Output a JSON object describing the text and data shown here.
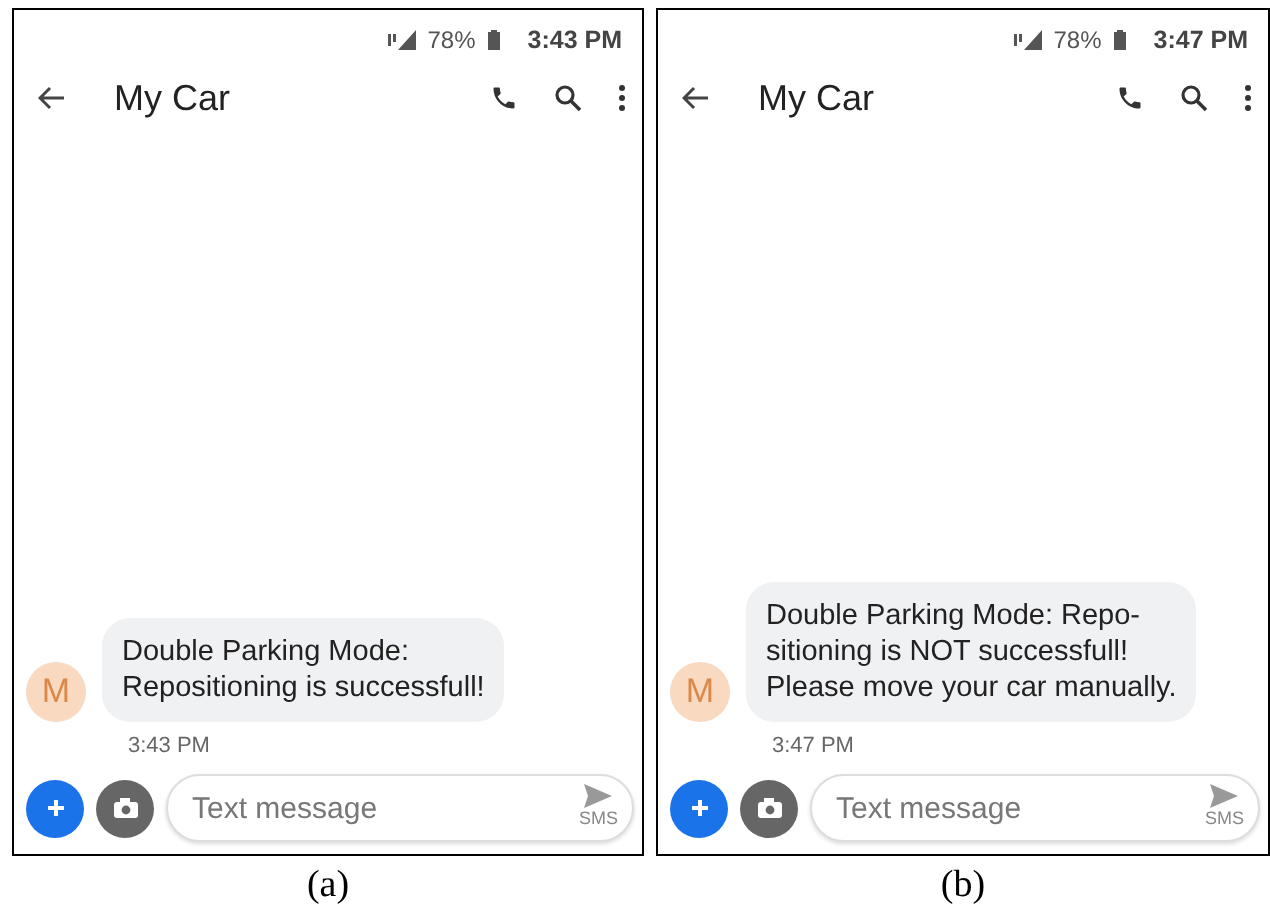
{
  "panels": [
    {
      "caption": "(a)",
      "status_bar": {
        "battery": "78%",
        "time": "3:43 PM"
      },
      "toolbar": {
        "title": "My Car"
      },
      "message": {
        "avatar": "M",
        "lines": [
          "Double Parking Mode:",
          "Repositioning is successfull!"
        ],
        "time": "3:43 PM"
      },
      "composer": {
        "placeholder": "Text message",
        "send_label": "SMS"
      }
    },
    {
      "caption": "(b)",
      "status_bar": {
        "battery": "78%",
        "time": "3:47 PM"
      },
      "toolbar": {
        "title": "My Car"
      },
      "message": {
        "avatar": "M",
        "lines": [
          "Double Parking Mode: Repo-",
          "sitioning is NOT successfull!",
          "Please move your car manually."
        ],
        "time": "3:47 PM"
      },
      "composer": {
        "placeholder": "Text message",
        "send_label": "SMS"
      }
    }
  ]
}
